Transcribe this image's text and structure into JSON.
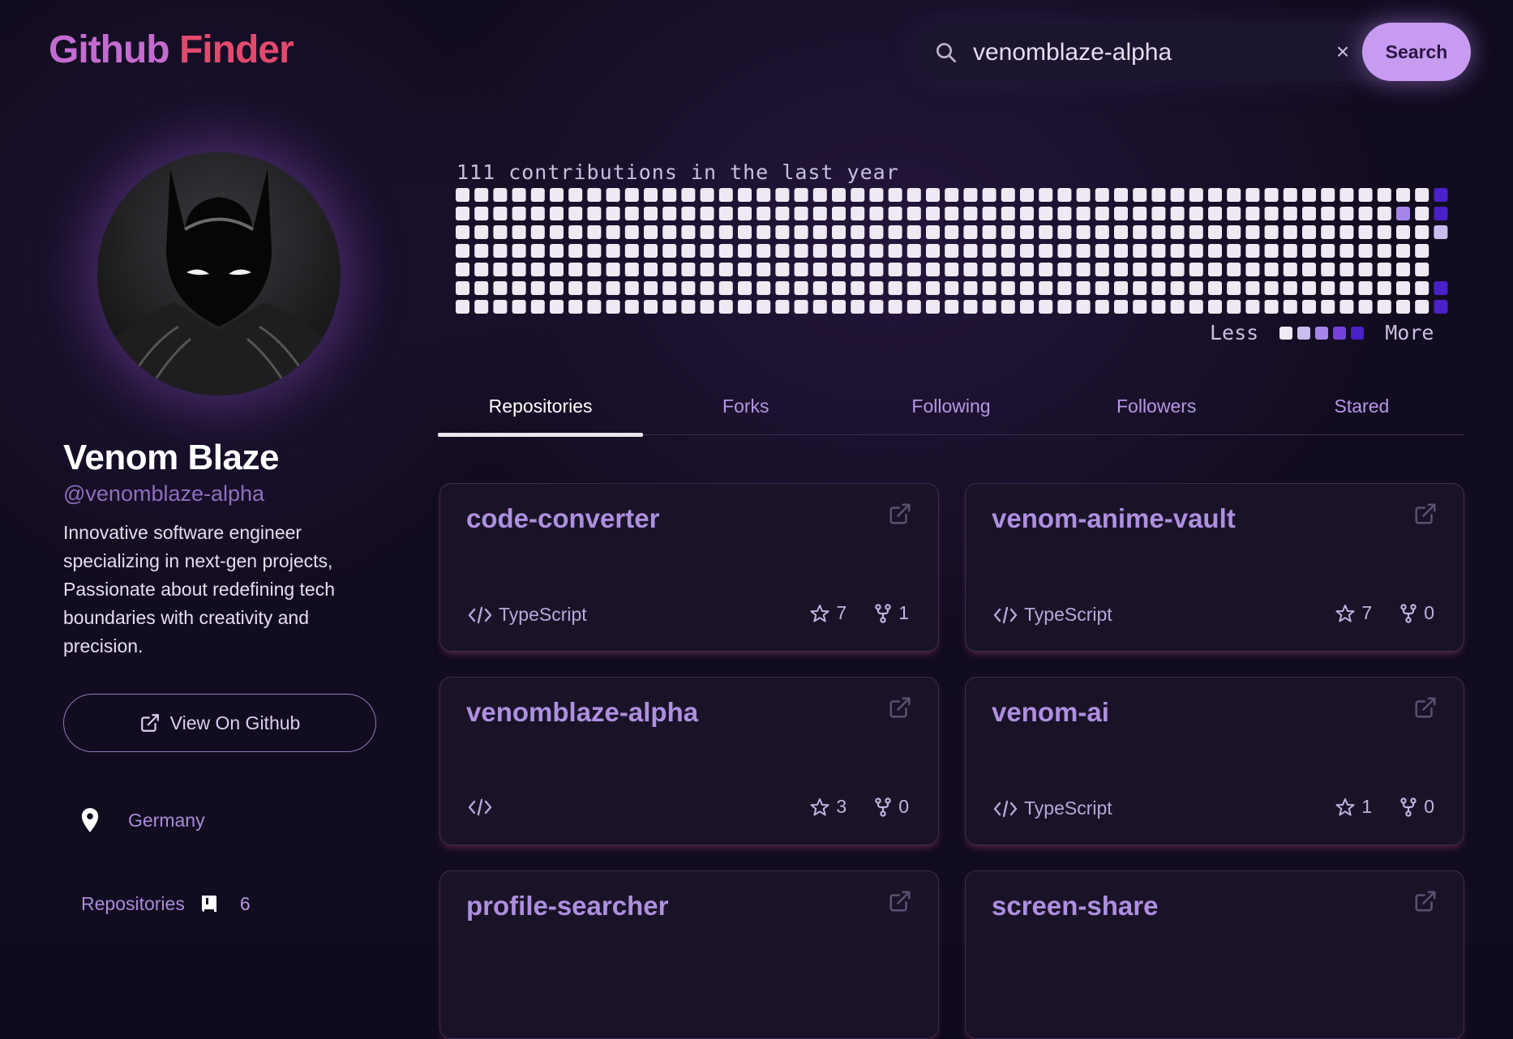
{
  "brand": {
    "part1": "Github",
    "part2": "Finder"
  },
  "search": {
    "value": "venomblaze-alpha",
    "clear_label": "×",
    "button_label": "Search"
  },
  "profile": {
    "name": "Venom Blaze",
    "handle": "@venomblaze-alpha",
    "bio": "Innovative software engineer specializing in next-gen projects, Passionate about redefining tech boundaries with creativity and precision.",
    "view_button": "View On Github",
    "location": "Germany",
    "repositories_label": "Repositories",
    "repositories_count": "6"
  },
  "contributions": {
    "title": "111 contributions in the last year",
    "less_label": "Less",
    "more_label": "More",
    "weeks": 53,
    "days": 7,
    "level_colors": [
      "#eee9f2",
      "#cbbcef",
      "#a586e8",
      "#7442d8",
      "#4a20c8"
    ],
    "active_cells": [
      {
        "week": 52,
        "day": 0,
        "level": 4
      },
      {
        "week": 52,
        "day": 1,
        "level": 4
      },
      {
        "week": 52,
        "day": 2,
        "level": 1
      },
      {
        "week": 50,
        "day": 1,
        "level": 2
      },
      {
        "week": 52,
        "day": 5,
        "level": 4
      },
      {
        "week": 52,
        "day": 6,
        "level": 4
      }
    ]
  },
  "tabs": [
    {
      "label": "Repositories",
      "active": true
    },
    {
      "label": "Forks",
      "active": false
    },
    {
      "label": "Following",
      "active": false
    },
    {
      "label": "Followers",
      "active": false
    },
    {
      "label": "Stared",
      "active": false
    }
  ],
  "repos": [
    {
      "name": "code-converter",
      "language": "TypeScript",
      "stars": "7",
      "forks": "1"
    },
    {
      "name": "venom-anime-vault",
      "language": "TypeScript",
      "stars": "7",
      "forks": "0"
    },
    {
      "name": "venomblaze-alpha",
      "language": "",
      "stars": "3",
      "forks": "0"
    },
    {
      "name": "venom-ai",
      "language": "TypeScript",
      "stars": "1",
      "forks": "0"
    },
    {
      "name": "profile-searcher",
      "language": "",
      "stars": "",
      "forks": ""
    },
    {
      "name": "screen-share",
      "language": "",
      "stars": "",
      "forks": ""
    }
  ]
}
